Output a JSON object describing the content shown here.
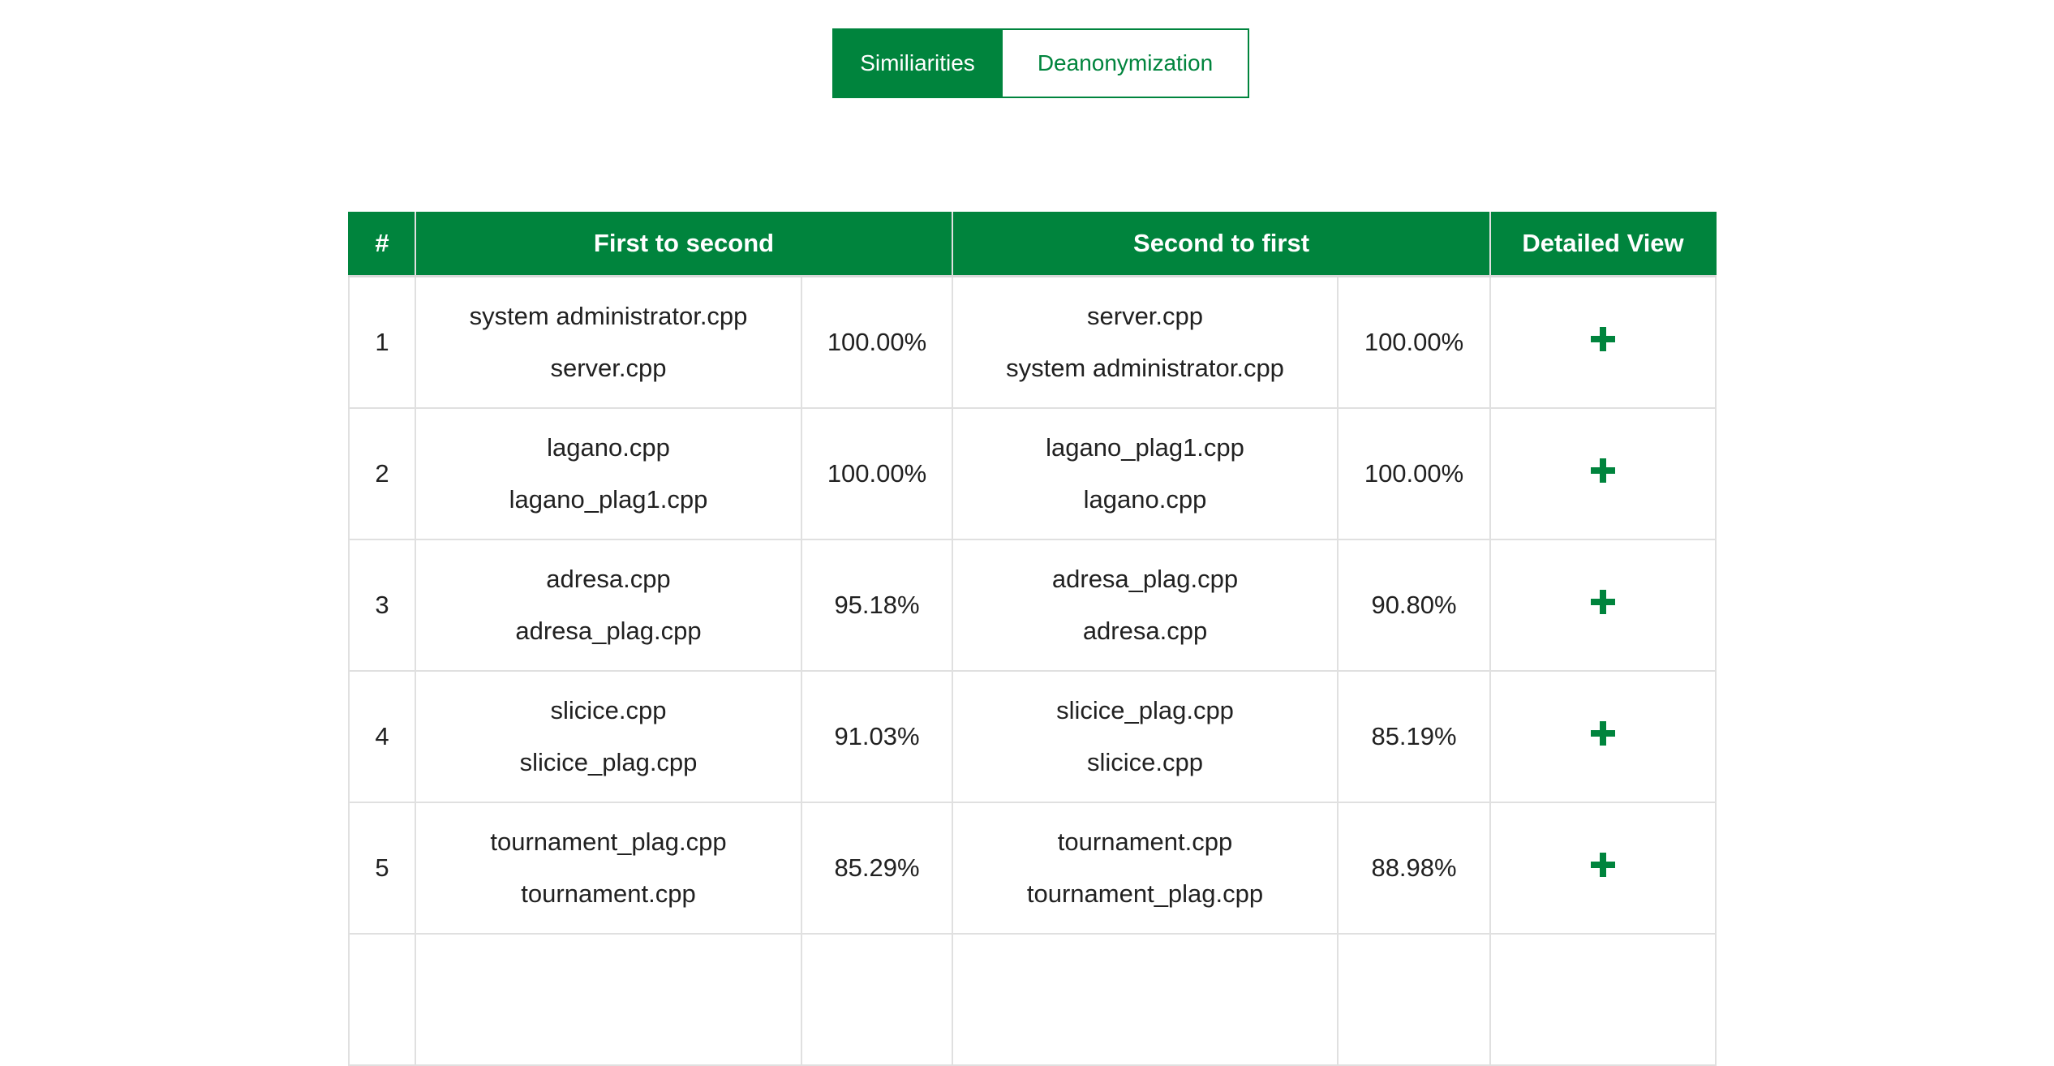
{
  "tabs": {
    "similarities": "Similiarities",
    "deanonymization": "Deanonymization"
  },
  "table": {
    "headers": {
      "index": "#",
      "first_to_second": "First to second",
      "second_to_first": "Second to first",
      "detailed_view": "Detailed View"
    },
    "rows": [
      {
        "index": "1",
        "fts_file1": "system administrator.cpp",
        "fts_file2": "server.cpp",
        "fts_pct": "100.00%",
        "stf_file1": "server.cpp",
        "stf_file2": "system administrator.cpp",
        "stf_pct": "100.00%",
        "action_icon": "plus-icon"
      },
      {
        "index": "2",
        "fts_file1": "lagano.cpp",
        "fts_file2": "lagano_plag1.cpp",
        "fts_pct": "100.00%",
        "stf_file1": "lagano_plag1.cpp",
        "stf_file2": "lagano.cpp",
        "stf_pct": "100.00%",
        "action_icon": "plus-icon"
      },
      {
        "index": "3",
        "fts_file1": "adresa.cpp",
        "fts_file2": "adresa_plag.cpp",
        "fts_pct": "95.18%",
        "stf_file1": "adresa_plag.cpp",
        "stf_file2": "adresa.cpp",
        "stf_pct": "90.80%",
        "action_icon": "plus-icon"
      },
      {
        "index": "4",
        "fts_file1": "slicice.cpp",
        "fts_file2": "slicice_plag.cpp",
        "fts_pct": "91.03%",
        "stf_file1": "slicice_plag.cpp",
        "stf_file2": "slicice.cpp",
        "stf_pct": "85.19%",
        "action_icon": "plus-icon"
      },
      {
        "index": "5",
        "fts_file1": "tournament_plag.cpp",
        "fts_file2": "tournament.cpp",
        "fts_pct": "85.29%",
        "stf_file1": "tournament.cpp",
        "stf_file2": "tournament_plag.cpp",
        "stf_pct": "88.98%",
        "action_icon": "plus-icon"
      },
      {
        "index": "",
        "fts_file1": "",
        "fts_file2": "",
        "fts_pct": "",
        "stf_file1": "",
        "stf_file2": "",
        "stf_pct": "",
        "action_icon": ""
      }
    ]
  },
  "colors": {
    "accent": "#00843d",
    "border": "#e0e0e0",
    "text": "#212121"
  }
}
